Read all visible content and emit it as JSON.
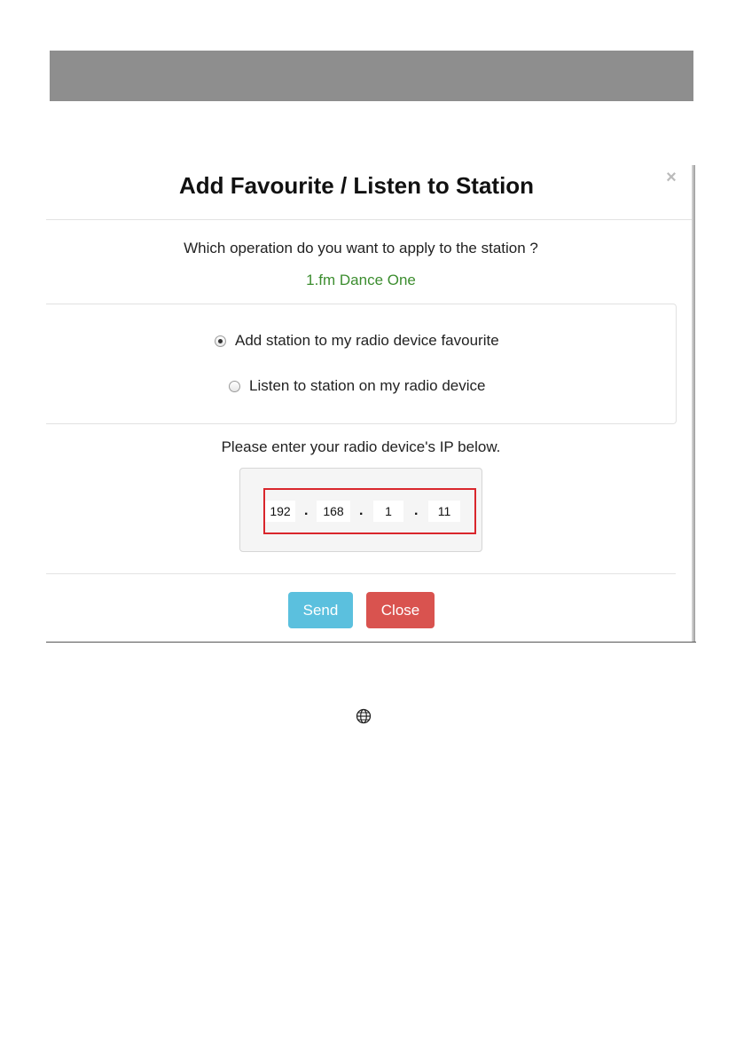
{
  "modal": {
    "title": "Add Favourite / Listen to Station",
    "close_glyph": "×",
    "question": "Which operation do you want to apply to the station ?",
    "station_name": "1.fm Dance One",
    "options": [
      {
        "label": "Add station to my radio device favourite",
        "checked": true
      },
      {
        "label": "Listen to station on my radio device",
        "checked": false
      }
    ],
    "ip_prompt": "Please enter your radio device's IP below.",
    "ip": {
      "octets": [
        "192",
        "168",
        "1",
        "11"
      ],
      "separator": "."
    },
    "buttons": {
      "send_label": "Send",
      "close_label": "Close"
    }
  },
  "colors": {
    "station_name": "#3c8d2f",
    "send_button": "#5bc0de",
    "close_button": "#d9534f",
    "ip_highlight_border": "#d9262c",
    "top_bar": "#8e8e8e"
  },
  "icons": {
    "footer_icon": "globe-icon"
  }
}
